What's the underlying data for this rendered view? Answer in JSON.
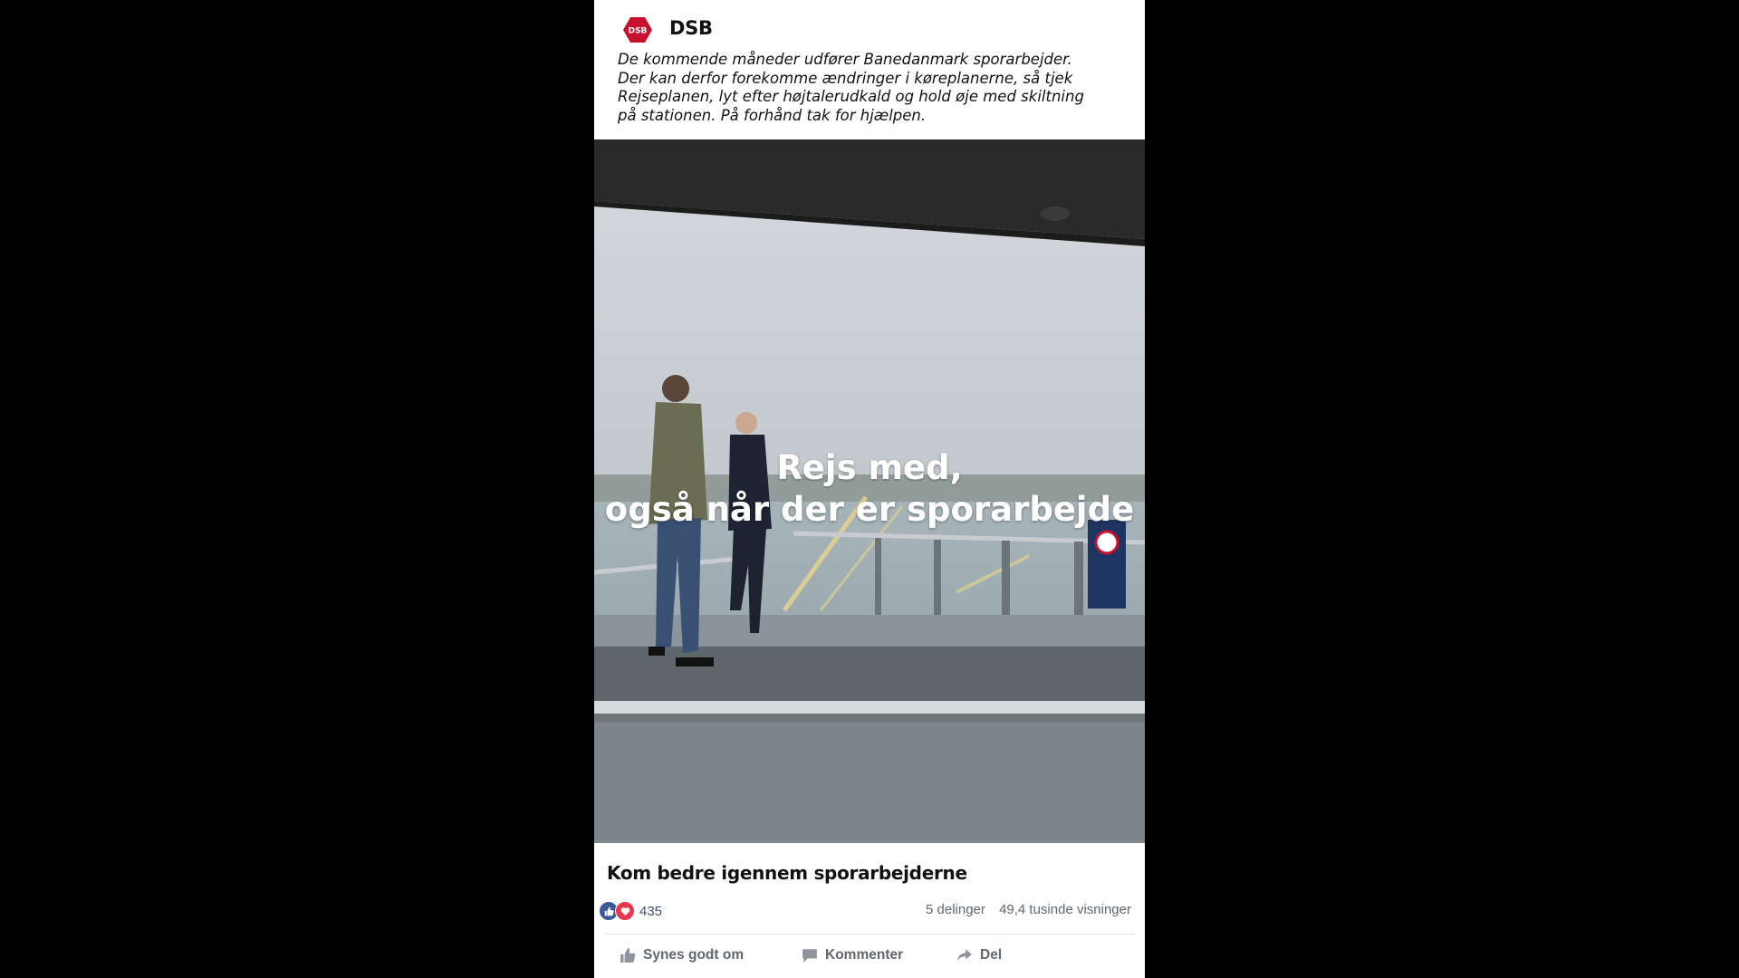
{
  "post": {
    "page_name": "DSB",
    "logo_text": "DSB",
    "text_lines": [
      "De kommende måneder udfører Banedanmark sporarbejder.",
      "Der kan derfor forekomme ændringer i køreplanerne, så tjek",
      "Rejseplanen, lyt efter højtalerudkald og hold øje med skiltning",
      "på stationen. På forhånd tak for hjælpen."
    ]
  },
  "video": {
    "overlay_line1": "Rejs med,",
    "overlay_line2": "også når der er sporarbejde"
  },
  "link": {
    "title": "Kom bedre igennem sporarbejderne"
  },
  "engagement": {
    "reaction_icons": [
      "like-icon",
      "love-icon"
    ],
    "reaction_count": "435",
    "shares": "5 delinger",
    "views": "49,4 tusinde visninger"
  },
  "actions": {
    "like_label": "Synes godt om",
    "comment_label": "Kommenter",
    "share_label": "Del"
  },
  "colors": {
    "background": "#000000",
    "card": "#ffffff",
    "brand_red": "#c8102e",
    "facebook_blue": "#3b5998",
    "love_red": "#e8384f",
    "muted_text": "#606770"
  }
}
